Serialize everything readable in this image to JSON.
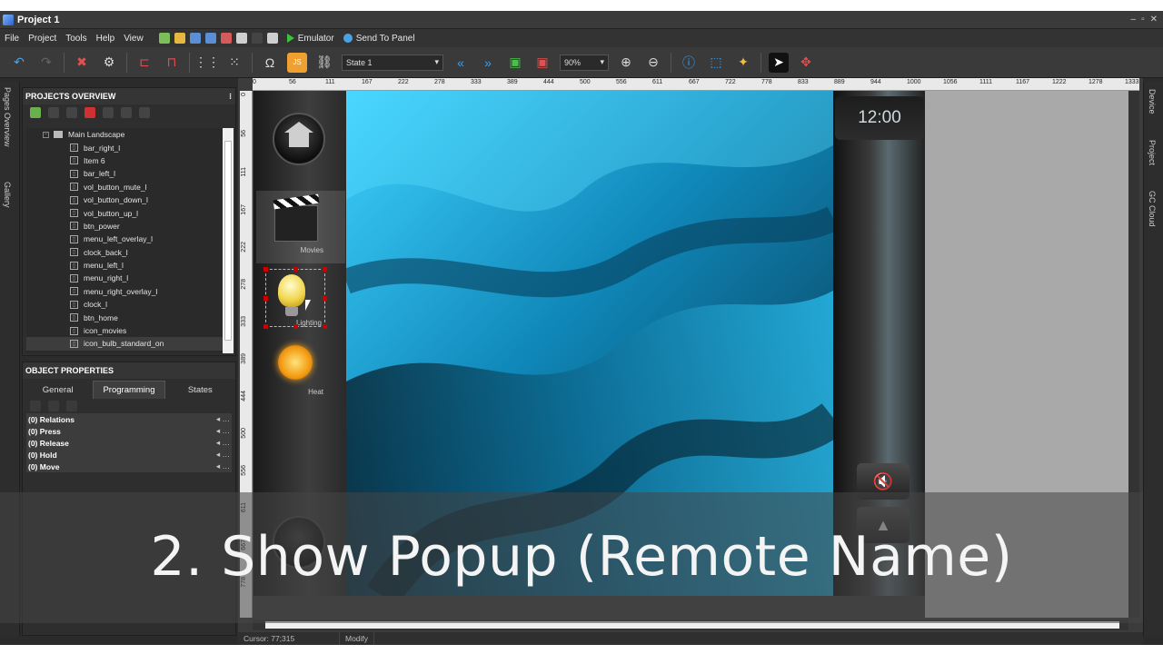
{
  "window": {
    "title": "Project 1",
    "controls": [
      "–",
      "▫",
      "✕"
    ]
  },
  "menubar": {
    "items": [
      "File",
      "Project",
      "Tools",
      "Help",
      "View"
    ],
    "emulator_label": "Emulator",
    "send_label": "Send To Panel"
  },
  "toolbar": {
    "state_value": "State 1",
    "zoom_value": "90%"
  },
  "left_tabs": {
    "pages_overview": "Pages Overview",
    "gallery": "Gallery"
  },
  "projects_overview": {
    "title": "PROJECTS OVERVIEW",
    "root": "Main Landscape",
    "items": [
      "bar_right_l",
      "Item 6",
      "bar_left_l",
      "vol_button_mute_l",
      "vol_button_down_l",
      "vol_button_up_l",
      "btn_power",
      "menu_left_overlay_l",
      "clock_back_l",
      "menu_left_l",
      "menu_right_l",
      "menu_right_overlay_l",
      "clock_l",
      "btn_home",
      "icon_movies",
      "icon_bulb_standard_on"
    ]
  },
  "object_properties": {
    "title": "OBJECT PROPERTIES",
    "tabs": [
      "General",
      "Programming",
      "States"
    ],
    "active_tab": "Programming",
    "events": [
      "(0) Relations",
      "(0) Press",
      "(0) Release",
      "(0) Hold",
      "(0) Move"
    ]
  },
  "ruler": {
    "h_ticks": [
      "0",
      "56",
      "111",
      "167",
      "222",
      "278",
      "333",
      "389",
      "444",
      "500",
      "556",
      "611",
      "667",
      "722",
      "778",
      "833",
      "889",
      "944",
      "1000",
      "1056",
      "1111",
      "1167",
      "1222",
      "1278",
      "1333"
    ],
    "v_ticks": [
      "0",
      "56",
      "111",
      "167",
      "222",
      "278",
      "333",
      "389",
      "444",
      "500",
      "556",
      "611",
      "667",
      "778"
    ]
  },
  "remote": {
    "menu_labels": {
      "movies": "Movies",
      "lighting": "Lighting",
      "heat": "Heat"
    },
    "clock": "12:00"
  },
  "right_tabs": {
    "device": "Device",
    "project": "Project",
    "gc_cloud": "GC Cloud"
  },
  "caption": "2. Show Popup (Remote Name)",
  "status": {
    "cursor": "Cursor: 77;315",
    "mode": "Modify"
  },
  "colors": {
    "accent": "#1fb6e8",
    "selection": "#cc0000"
  }
}
